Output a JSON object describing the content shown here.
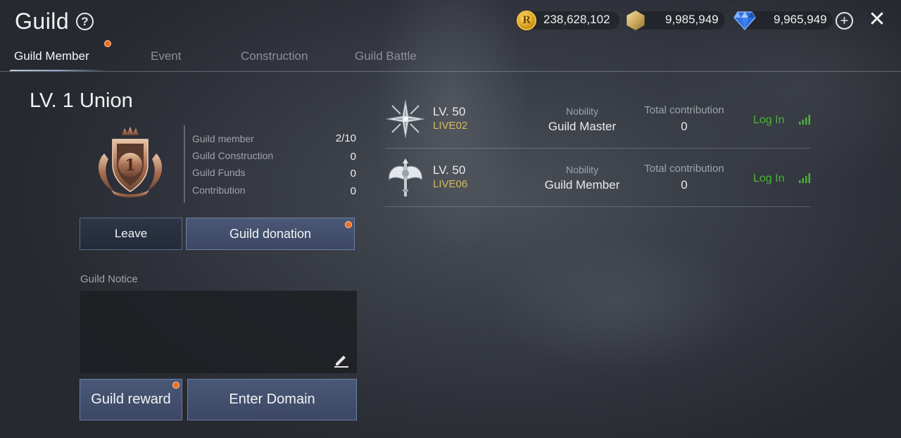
{
  "header": {
    "title": "Guild",
    "help_symbol": "?",
    "currencies": [
      {
        "icon": "gold-coin-icon",
        "value": "238,628,102"
      },
      {
        "icon": "hex-gem-icon",
        "value": "9,985,949"
      },
      {
        "icon": "blue-diamond-icon",
        "value": "9,965,949"
      }
    ]
  },
  "tabs": [
    {
      "label": "Guild Member",
      "active": true,
      "notification": true
    },
    {
      "label": "Event",
      "active": false
    },
    {
      "label": "Construction",
      "active": false
    },
    {
      "label": "Guild Battle",
      "active": false
    }
  ],
  "guild": {
    "level_title": "LV. 1 Union",
    "emblem_number": "1",
    "stats": [
      {
        "label": "Guild member",
        "value": "2/10"
      },
      {
        "label": "Guild Construction",
        "value": "0"
      },
      {
        "label": "Guild Funds",
        "value": "0"
      },
      {
        "label": "Contribution",
        "value": "0"
      }
    ],
    "leave_label": "Leave",
    "donation_label": "Guild donation",
    "notice_label": "Guild Notice",
    "notice_text": "",
    "reward_label": "Guild reward",
    "domain_label": "Enter Domain"
  },
  "members": [
    {
      "level": "LV. 50",
      "name": "LIVE02",
      "nobility_header": "Nobility",
      "nobility": "Guild Master",
      "contribution_header": "Total contribution",
      "contribution": "0",
      "status": "Log In",
      "icon": "compass-star-icon"
    },
    {
      "level": "LV. 50",
      "name": "LIVE06",
      "nobility_header": "Nobility",
      "nobility": "Guild Member",
      "contribution_header": "Total contribution",
      "contribution": "0",
      "status": "Log In",
      "icon": "battle-axe-icon"
    }
  ],
  "colors": {
    "accent_orange": "#f26c1e",
    "member_name": "#d4bb5e",
    "online_green": "#4bb33a",
    "button_blue": "#4a5877"
  }
}
